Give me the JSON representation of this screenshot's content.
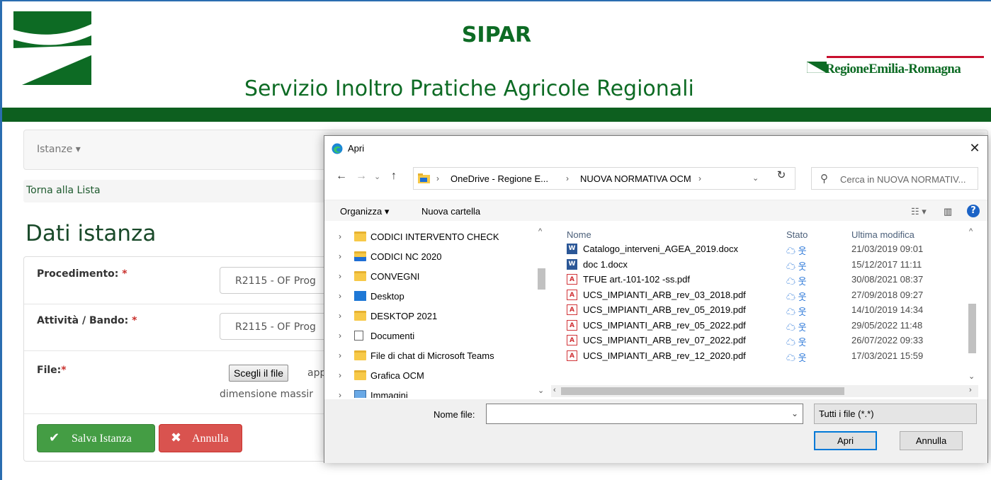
{
  "header": {
    "title": "SIPAR",
    "subtitle": "Servizio Inoltro Pratiche Agricole Regionali",
    "region_logo_text": "RegioneEmilia-Romagna",
    "brand_color": "#0d6b24"
  },
  "nav": {
    "istanze_label": "Istanze ▾"
  },
  "breadcrumb": {
    "back_label": "Torna alla Lista"
  },
  "page": {
    "heading": "Dati istanza"
  },
  "form": {
    "procedimento": {
      "label": "Procedimento:",
      "required": "*",
      "value": "R2115 - OF Prog"
    },
    "attivita": {
      "label": "Attività / Bando:",
      "required": "*",
      "value": "R2115 - OF Prog"
    },
    "file": {
      "label": "File:",
      "required": "*",
      "choose_label": "Scegli il file",
      "note_line1": "app",
      "note_line2": "dimensione massir"
    },
    "save_label": "Salva  Istanza",
    "cancel_label": "Annulla",
    "save_color": "#449d44",
    "cancel_color": "#d9534f"
  },
  "dialog": {
    "title": "Apri",
    "close_label": "✕",
    "address": {
      "segments": [
        "OneDrive - Regione E...",
        "NUOVA NORMATIVA OCM"
      ],
      "search_placeholder": "Cerca in NUOVA NORMATIV..."
    },
    "toolbar": {
      "organize_label": "Organizza ▾",
      "new_folder_label": "Nuova cartella"
    },
    "tree": [
      {
        "label": "CODICI INTERVENTO CHECK",
        "icon": "folder-icon"
      },
      {
        "label": "CODICI NC 2020",
        "icon": "shared-folder-icon"
      },
      {
        "label": "CONVEGNI",
        "icon": "folder-icon"
      },
      {
        "label": "Desktop",
        "icon": "desktop-icon"
      },
      {
        "label": "DESKTOP 2021",
        "icon": "folder-icon"
      },
      {
        "label": "Documenti",
        "icon": "documents-icon"
      },
      {
        "label": "File di chat di Microsoft Teams",
        "icon": "folder-icon"
      },
      {
        "label": "Grafica OCM",
        "icon": "folder-icon"
      },
      {
        "label": "Immagini",
        "icon": "pictures-icon"
      }
    ],
    "columns": {
      "name": "Nome",
      "status": "Stato",
      "modified": "Ultima modifica"
    },
    "files": [
      {
        "name": "Catalogo_interveni_AGEA_2019.docx",
        "type": "docx",
        "status": "☁ 웃",
        "modified": "21/03/2019 09:01"
      },
      {
        "name": "doc 1.docx",
        "type": "docx",
        "status": "☁ 웃",
        "modified": "15/12/2017 11:11"
      },
      {
        "name": "TFUE art.-101-102 -ss.pdf",
        "type": "pdf",
        "status": "☁ 웃",
        "modified": "30/08/2021 08:37"
      },
      {
        "name": "UCS_IMPIANTI_ARB_rev_03_2018.pdf",
        "type": "pdf",
        "status": "☁ 웃",
        "modified": "27/09/2018 09:27"
      },
      {
        "name": "UCS_IMPIANTI_ARB_rev_05_2019.pdf",
        "type": "pdf",
        "status": "☁ 웃",
        "modified": "14/10/2019 14:34"
      },
      {
        "name": "UCS_IMPIANTI_ARB_rev_05_2022.pdf",
        "type": "pdf",
        "status": "☁ 웃",
        "modified": "29/05/2022 11:48"
      },
      {
        "name": "UCS_IMPIANTI_ARB_rev_07_2022.pdf",
        "type": "pdf",
        "status": "☁ 웃",
        "modified": "26/07/2022 09:33"
      },
      {
        "name": "UCS_IMPIANTI_ARB_rev_12_2020.pdf",
        "type": "pdf",
        "status": "☁ 웃",
        "modified": "17/03/2021 15:59"
      }
    ],
    "filename_label": "Nome file:",
    "filename_value": "",
    "filetype_value": "Tutti i file (*.*)",
    "open_label": "Apri",
    "cancel_label": "Annulla"
  }
}
